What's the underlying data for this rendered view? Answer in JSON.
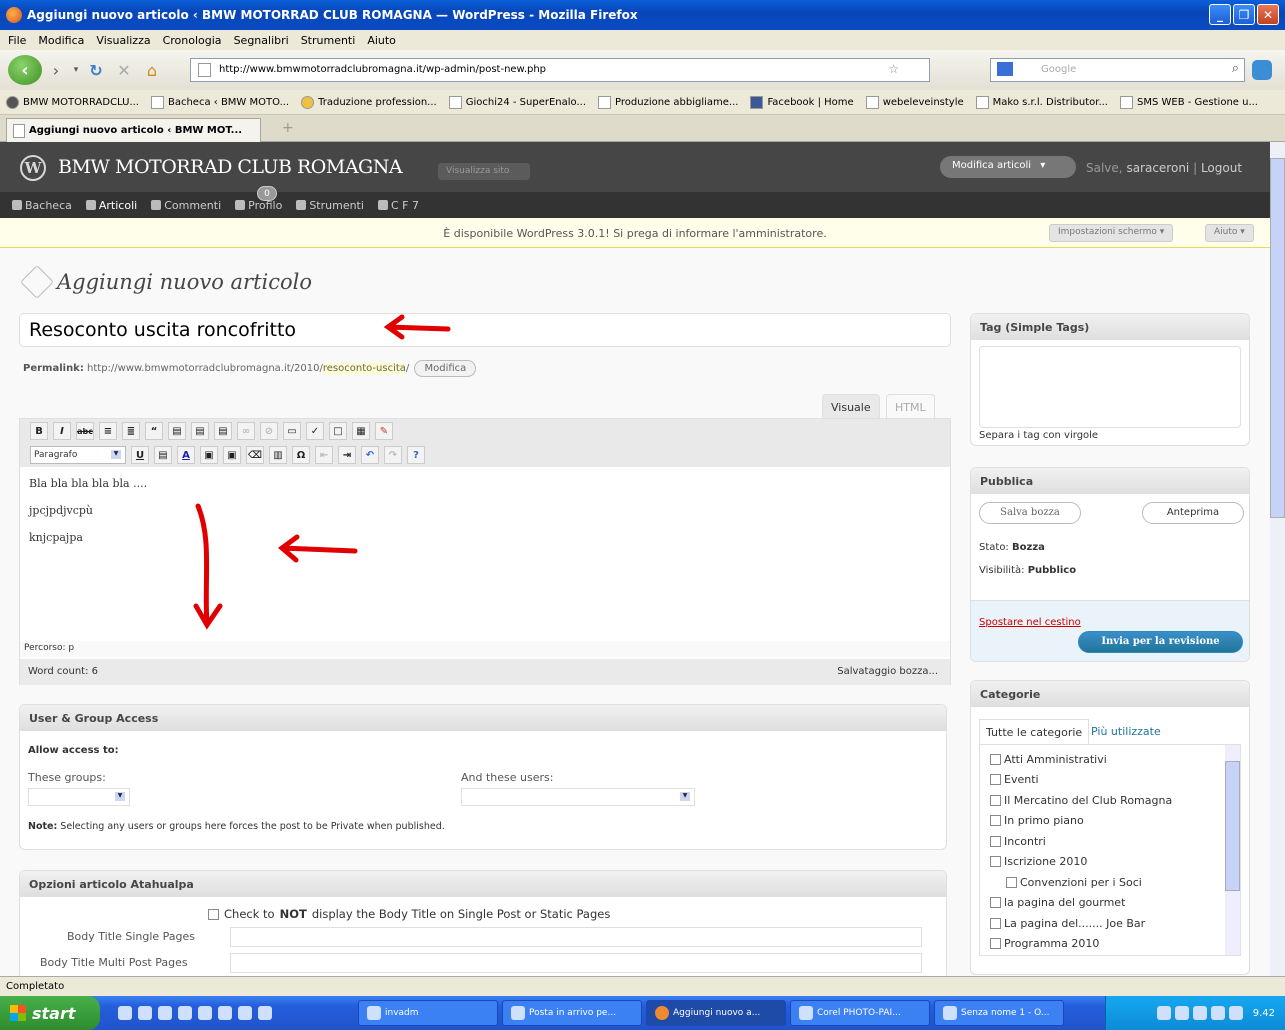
{
  "window": {
    "title": "Aggiungi nuovo articolo ‹ BMW MOTORRAD CLUB ROMAGNA — WordPress - Mozilla Firefox",
    "minimize": "_",
    "maximize": "❐",
    "close": "✕"
  },
  "menubar": [
    "File",
    "Modifica",
    "Visualizza",
    "Cronologia",
    "Segnalibri",
    "Strumenti",
    "Aiuto"
  ],
  "nav": {
    "url": "http://www.bmwmotorradclubromagna.it/wp-admin/post-new.php",
    "search_placeholder": "Google"
  },
  "bookmarks": [
    "BMW MOTORRADCLU...",
    "Bacheca ‹ BMW MOTO...",
    "Traduzione profession...",
    "Giochi24 - SuperEnalo...",
    "Produzione abbigliame...",
    "Facebook | Home",
    "webeleveinstyle",
    "Mako s.r.l. Distributor...",
    "SMS WEB - Gestione u..."
  ],
  "tab": {
    "label": "Aggiungi nuovo articolo ‹ BMW MOT...",
    "new_tab": "+"
  },
  "wp_header": {
    "site_name": "BMW MOTORRAD CLUB ROMAGNA",
    "view_site": "Visualizza sito",
    "fav_action": "Modifica articoli",
    "greeting": "Salve,",
    "user": "saraceroni",
    "logout": "Logout"
  },
  "wp_menu": [
    {
      "label": "Bacheca"
    },
    {
      "label": "Articoli"
    },
    {
      "label": "Commenti"
    },
    {
      "label": "Profilo"
    },
    {
      "label": "Strumenti"
    },
    {
      "label": "C F 7"
    }
  ],
  "comments_count": "0",
  "nag": "È disponibile WordPress 3.0.1! Si prega di informare l'amministratore.",
  "screen_options": "Impostazioni schermo",
  "help": "Aiuto",
  "page_title": "Aggiungi nuovo articolo",
  "post_title": "Resoconto uscita roncofritto",
  "permalink": {
    "label": "Permalink:",
    "base": "http://www.bmwmotorradclubromagna.it/2010/",
    "slug": "resoconto-uscita",
    "end": "/",
    "edit": "Modifica"
  },
  "editor_tabs": {
    "visual": "Visuale",
    "html": "HTML"
  },
  "format_select": "Paragrafo",
  "editor_content": [
    "Bla bla bla bla bla ....",
    "jpcjpdjvcpù",
    "knjcpajpa"
  ],
  "path": "Percorso: p",
  "word_count": "Word count: 6",
  "draft_saving": "Salvataggio bozza...",
  "user_group_box": {
    "title": "User & Group Access",
    "allow": "Allow access to:",
    "groups_label": "These groups:",
    "users_label": "And these users:",
    "note_bold": "Note:",
    "note": "Selecting any users or groups here forces the post to be Private when published."
  },
  "atahualpa_box": {
    "title": "Opzioni articolo Atahualpa",
    "check_pre": "Check to",
    "check_bold": "NOT",
    "check_post": "display the Body Title on Single Post or Static Pages",
    "single_label": "Body Title Single Pages",
    "multi_label": "Body Title Multi Post Pages"
  },
  "tags_box": {
    "title": "Tag (Simple Tags)",
    "hint": "Separa i tag con virgole"
  },
  "publish_box": {
    "title": "Pubblica",
    "save_draft": "Salva bozza",
    "preview": "Anteprima",
    "status_label": "Stato:",
    "status_value": "Bozza",
    "visibility_label": "Visibilità:",
    "visibility_value": "Pubblico",
    "trash": "Spostare nel cestino",
    "submit": "Invia per la revisione"
  },
  "categories_box": {
    "title": "Categorie",
    "tab_all": "Tutte le categorie",
    "tab_popular": "Più utilizzate",
    "items": [
      {
        "label": "Atti Amministrativi",
        "sub": false
      },
      {
        "label": "Eventi",
        "sub": false
      },
      {
        "label": "Il Mercatino del Club Romagna",
        "sub": false
      },
      {
        "label": "In primo piano",
        "sub": false
      },
      {
        "label": "Incontri",
        "sub": false
      },
      {
        "label": "Iscrizione 2010",
        "sub": false
      },
      {
        "label": "Convenzioni per i Soci",
        "sub": true
      },
      {
        "label": "la pagina del gourmet",
        "sub": false
      },
      {
        "label": "La pagina del....... Joe Bar",
        "sub": false
      },
      {
        "label": "Programma 2010",
        "sub": false
      }
    ]
  },
  "status_bar": "Completato",
  "taskbar": {
    "start": "start",
    "tasks": [
      "invadm",
      "Posta in arrivo pe...",
      "Aggiungi nuovo a...",
      "Corel PHOTO-PAI...",
      "Senza nome 1 - O..."
    ],
    "clock": "9.42"
  },
  "colors": {
    "annotation_arrow": "#e00000",
    "wp_header": "#464646",
    "publish_button": "#21759b",
    "trash_link": "#cc0000"
  }
}
